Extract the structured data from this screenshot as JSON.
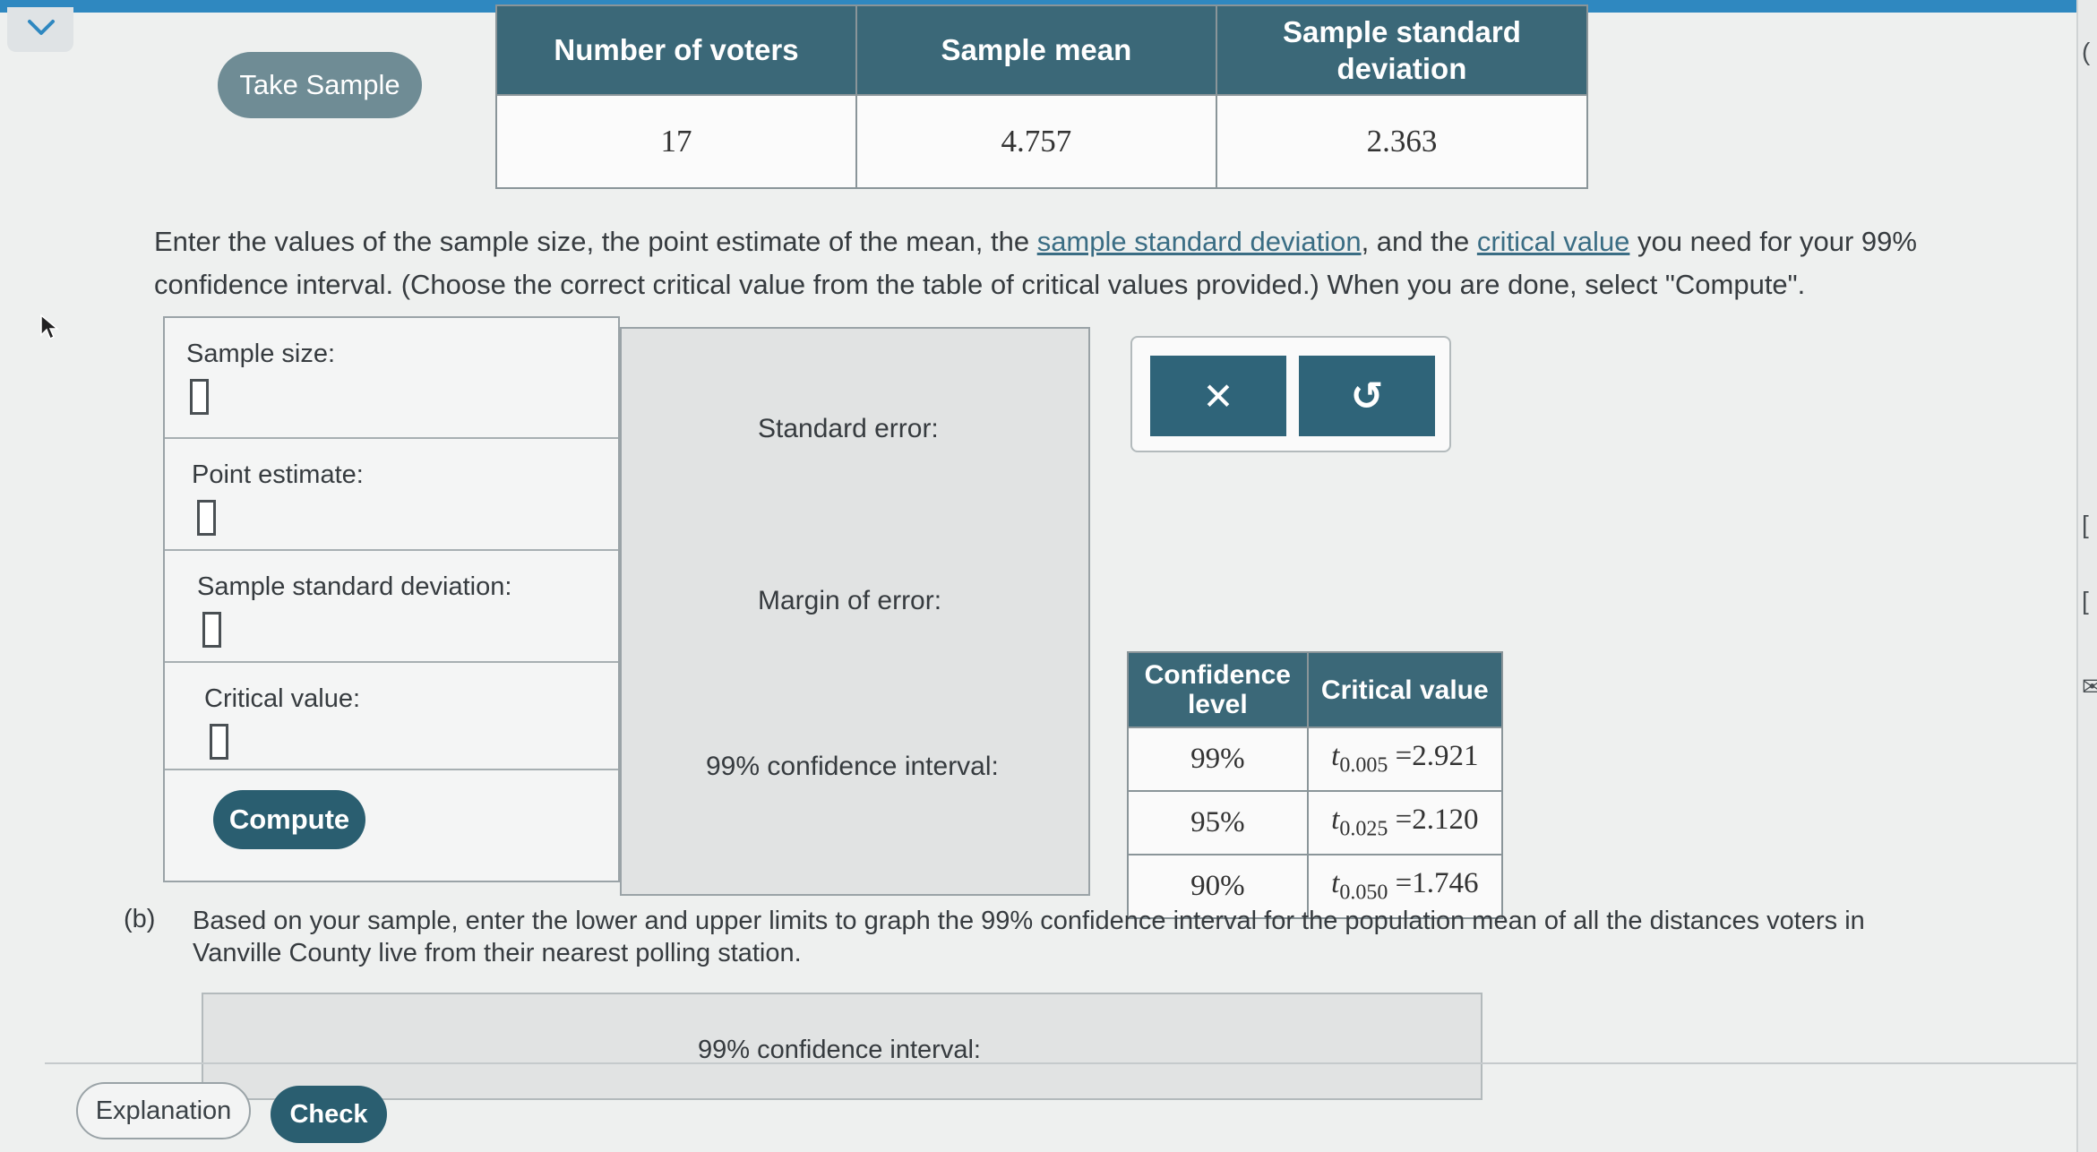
{
  "buttons": {
    "take_sample": "Take Sample",
    "compute": "Compute",
    "clear_symbol": "✕",
    "undo_symbol": "↺",
    "explanation": "Explanation",
    "check": "Check"
  },
  "sample_table": {
    "headers": [
      "Number of voters",
      "Sample mean",
      "Sample standard deviation"
    ],
    "row": [
      "17",
      "4.757",
      "2.363"
    ]
  },
  "instructions": {
    "before_link1": "Enter the values of the sample size, the point estimate of the mean, the ",
    "link1": "sample standard deviation",
    "between": ", and the ",
    "link2": "critical value",
    "after_link2": " you need for your 99% confidence interval. (Choose the correct critical value from the table of critical values provided.) When you are done, select \"Compute\"."
  },
  "inputs": {
    "sample_size": "Sample size:",
    "point_estimate": "Point estimate:",
    "sample_sd": "Sample standard deviation:",
    "critical_value": "Critical value:"
  },
  "results": {
    "standard_error": "Standard error:",
    "margin_of_error": "Margin of error:",
    "ci_99": "99% confidence interval:"
  },
  "critical_table": {
    "headers": [
      "Confidence level",
      "Critical value"
    ],
    "rows": [
      {
        "level": "99%",
        "t": "t",
        "sub": "0.005",
        "value": "=2.921"
      },
      {
        "level": "95%",
        "t": "t",
        "sub": "0.025",
        "value": "=2.120"
      },
      {
        "level": "90%",
        "t": "t",
        "sub": "0.050",
        "value": "=1.746"
      }
    ]
  },
  "part_b": {
    "letter": "(b)",
    "text": "Based on your sample, enter the lower and upper limits to graph the 99% confidence interval for the population mean of all the distances voters in Vanville County live from their nearest polling station.",
    "ci_label": "99% confidence interval:"
  },
  "icons": {
    "collapse": "chevron-down-icon",
    "cursor": "mouse-pointer-icon"
  },
  "colors": {
    "header_teal": "#3b6878",
    "button_dark": "#2a5e70",
    "button_gray": "#6f8c95",
    "accent_blue": "#2f88c0"
  }
}
